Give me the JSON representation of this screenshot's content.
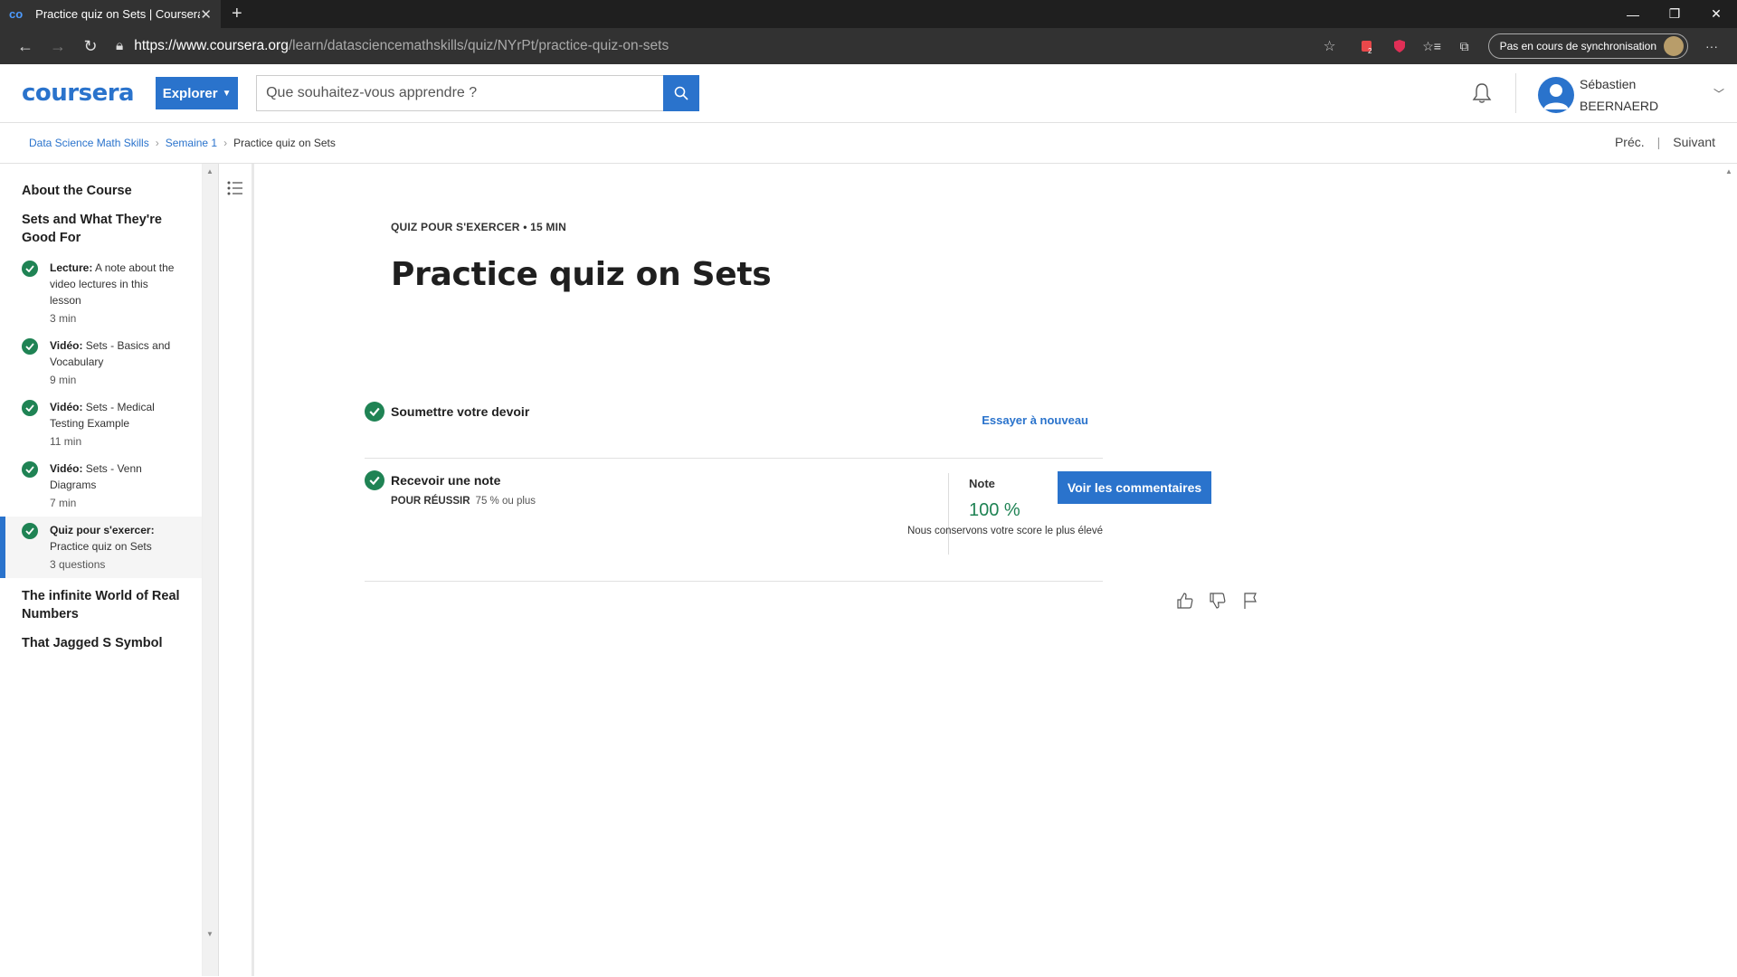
{
  "browser": {
    "tab_title": "Practice quiz on Sets | Coursera",
    "url_host": "https://www.coursera.org",
    "url_path": "/learn/datasciencemathskills/quiz/NYrPt/practice-quiz-on-sets",
    "sync_label": "Pas en cours de synchronisation",
    "ext_badge": "2"
  },
  "header": {
    "logo": "coursera",
    "explore_label": "Explorer",
    "search_placeholder": "Que souhaitez-vous apprendre ?",
    "user_first": "Sébastien",
    "user_last": "BEERNAERD"
  },
  "breadcrumb": {
    "items": [
      "Data Science Math Skills",
      "Semaine 1"
    ],
    "current": "Practice quiz on Sets",
    "prev": "Préc.",
    "next": "Suivant"
  },
  "sidebar": {
    "sections": [
      "About the Course",
      "Sets and What They're Good For",
      "The infinite World of Real Numbers",
      "That Jagged S Symbol"
    ],
    "items": [
      {
        "type": "Lecture:",
        "title": " A note about the video lectures in this lesson",
        "duration": "3  min"
      },
      {
        "type": "Vidéo:",
        "title": " Sets - Basics and Vocabulary",
        "duration": "9  min"
      },
      {
        "type": "Vidéo:",
        "title": " Sets - Medical Testing Example",
        "duration": "11  min"
      },
      {
        "type": "Vidéo:",
        "title": " Sets - Venn Diagrams",
        "duration": "7  min"
      },
      {
        "type": "Quiz pour s'exercer:",
        "title": " Practice quiz on Sets",
        "duration": "3 questions"
      }
    ]
  },
  "main": {
    "kicker": "QUIZ POUR S'EXERCER • 15  MIN",
    "title": "Practice quiz on Sets",
    "step1_label": "Soumettre votre devoir",
    "retry_label": "Essayer à nouveau",
    "step2_label": "Recevoir une note",
    "pass_label": "POUR RÉUSSIR",
    "pass_value": "75 % ou plus",
    "grade_label": "Note",
    "grade_value": "100 %",
    "feedback_button": "Voir les commentaires",
    "keep_note": "Nous conservons votre score le plus élevé"
  },
  "colors": {
    "accent": "#2a73cc",
    "success": "#1f8354"
  }
}
